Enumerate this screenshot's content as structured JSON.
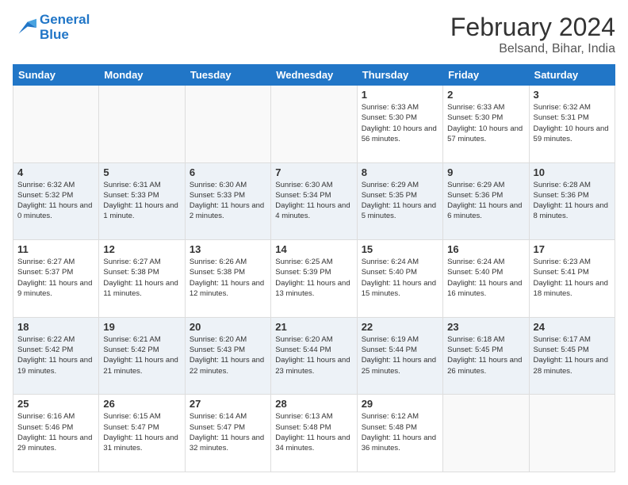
{
  "header": {
    "logo_line1": "General",
    "logo_line2": "Blue",
    "month_year": "February 2024",
    "location": "Belsand, Bihar, India"
  },
  "days_of_week": [
    "Sunday",
    "Monday",
    "Tuesday",
    "Wednesday",
    "Thursday",
    "Friday",
    "Saturday"
  ],
  "weeks": [
    [
      {
        "day": "",
        "sunrise": "",
        "sunset": "",
        "daylight": ""
      },
      {
        "day": "",
        "sunrise": "",
        "sunset": "",
        "daylight": ""
      },
      {
        "day": "",
        "sunrise": "",
        "sunset": "",
        "daylight": ""
      },
      {
        "day": "",
        "sunrise": "",
        "sunset": "",
        "daylight": ""
      },
      {
        "day": "1",
        "sunrise": "6:33 AM",
        "sunset": "5:30 PM",
        "daylight": "10 hours and 56 minutes."
      },
      {
        "day": "2",
        "sunrise": "6:33 AM",
        "sunset": "5:30 PM",
        "daylight": "10 hours and 57 minutes."
      },
      {
        "day": "3",
        "sunrise": "6:32 AM",
        "sunset": "5:31 PM",
        "daylight": "10 hours and 59 minutes."
      }
    ],
    [
      {
        "day": "4",
        "sunrise": "6:32 AM",
        "sunset": "5:32 PM",
        "daylight": "11 hours and 0 minutes."
      },
      {
        "day": "5",
        "sunrise": "6:31 AM",
        "sunset": "5:33 PM",
        "daylight": "11 hours and 1 minute."
      },
      {
        "day": "6",
        "sunrise": "6:30 AM",
        "sunset": "5:33 PM",
        "daylight": "11 hours and 2 minutes."
      },
      {
        "day": "7",
        "sunrise": "6:30 AM",
        "sunset": "5:34 PM",
        "daylight": "11 hours and 4 minutes."
      },
      {
        "day": "8",
        "sunrise": "6:29 AM",
        "sunset": "5:35 PM",
        "daylight": "11 hours and 5 minutes."
      },
      {
        "day": "9",
        "sunrise": "6:29 AM",
        "sunset": "5:36 PM",
        "daylight": "11 hours and 6 minutes."
      },
      {
        "day": "10",
        "sunrise": "6:28 AM",
        "sunset": "5:36 PM",
        "daylight": "11 hours and 8 minutes."
      }
    ],
    [
      {
        "day": "11",
        "sunrise": "6:27 AM",
        "sunset": "5:37 PM",
        "daylight": "11 hours and 9 minutes."
      },
      {
        "day": "12",
        "sunrise": "6:27 AM",
        "sunset": "5:38 PM",
        "daylight": "11 hours and 11 minutes."
      },
      {
        "day": "13",
        "sunrise": "6:26 AM",
        "sunset": "5:38 PM",
        "daylight": "11 hours and 12 minutes."
      },
      {
        "day": "14",
        "sunrise": "6:25 AM",
        "sunset": "5:39 PM",
        "daylight": "11 hours and 13 minutes."
      },
      {
        "day": "15",
        "sunrise": "6:24 AM",
        "sunset": "5:40 PM",
        "daylight": "11 hours and 15 minutes."
      },
      {
        "day": "16",
        "sunrise": "6:24 AM",
        "sunset": "5:40 PM",
        "daylight": "11 hours and 16 minutes."
      },
      {
        "day": "17",
        "sunrise": "6:23 AM",
        "sunset": "5:41 PM",
        "daylight": "11 hours and 18 minutes."
      }
    ],
    [
      {
        "day": "18",
        "sunrise": "6:22 AM",
        "sunset": "5:42 PM",
        "daylight": "11 hours and 19 minutes."
      },
      {
        "day": "19",
        "sunrise": "6:21 AM",
        "sunset": "5:42 PM",
        "daylight": "11 hours and 21 minutes."
      },
      {
        "day": "20",
        "sunrise": "6:20 AM",
        "sunset": "5:43 PM",
        "daylight": "11 hours and 22 minutes."
      },
      {
        "day": "21",
        "sunrise": "6:20 AM",
        "sunset": "5:44 PM",
        "daylight": "11 hours and 23 minutes."
      },
      {
        "day": "22",
        "sunrise": "6:19 AM",
        "sunset": "5:44 PM",
        "daylight": "11 hours and 25 minutes."
      },
      {
        "day": "23",
        "sunrise": "6:18 AM",
        "sunset": "5:45 PM",
        "daylight": "11 hours and 26 minutes."
      },
      {
        "day": "24",
        "sunrise": "6:17 AM",
        "sunset": "5:45 PM",
        "daylight": "11 hours and 28 minutes."
      }
    ],
    [
      {
        "day": "25",
        "sunrise": "6:16 AM",
        "sunset": "5:46 PM",
        "daylight": "11 hours and 29 minutes."
      },
      {
        "day": "26",
        "sunrise": "6:15 AM",
        "sunset": "5:47 PM",
        "daylight": "11 hours and 31 minutes."
      },
      {
        "day": "27",
        "sunrise": "6:14 AM",
        "sunset": "5:47 PM",
        "daylight": "11 hours and 32 minutes."
      },
      {
        "day": "28",
        "sunrise": "6:13 AM",
        "sunset": "5:48 PM",
        "daylight": "11 hours and 34 minutes."
      },
      {
        "day": "29",
        "sunrise": "6:12 AM",
        "sunset": "5:48 PM",
        "daylight": "11 hours and 36 minutes."
      },
      {
        "day": "",
        "sunrise": "",
        "sunset": "",
        "daylight": ""
      },
      {
        "day": "",
        "sunrise": "",
        "sunset": "",
        "daylight": ""
      }
    ]
  ]
}
